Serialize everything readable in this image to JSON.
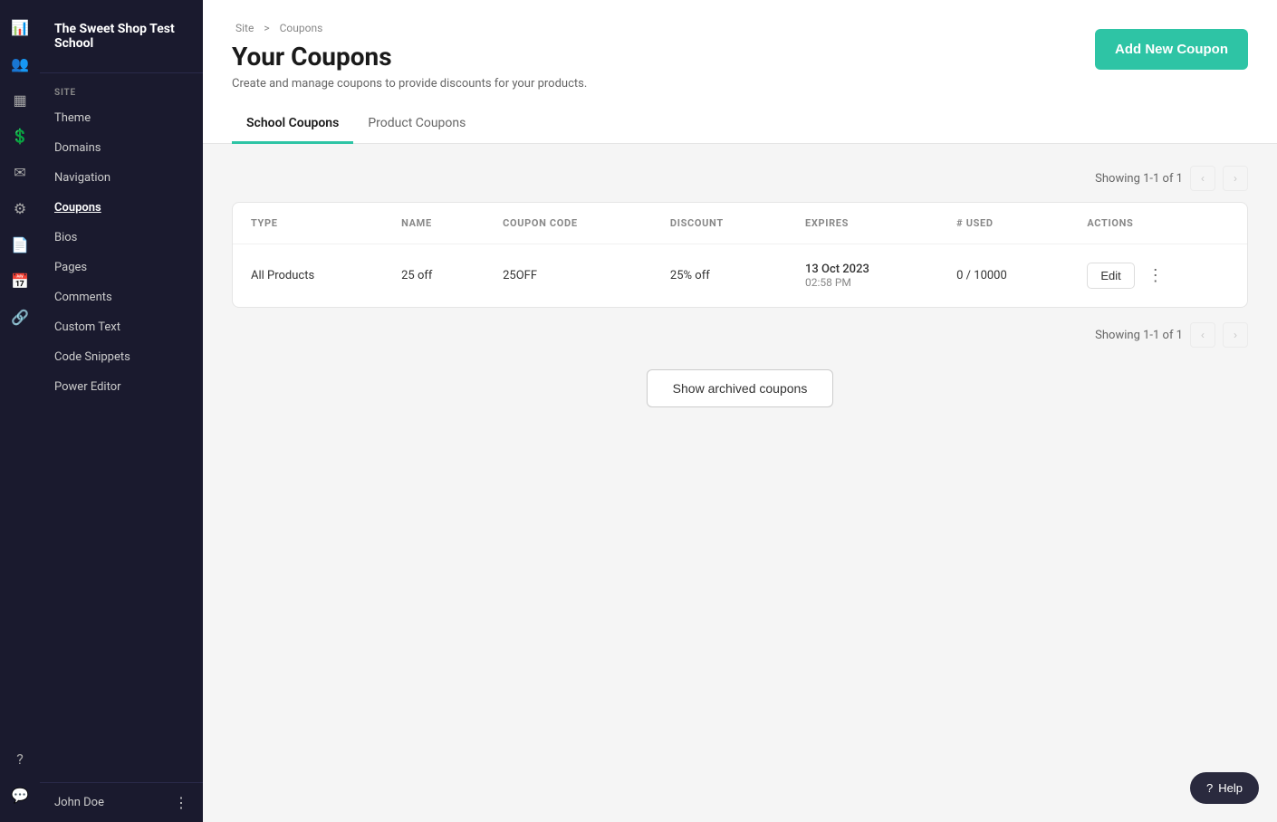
{
  "app": {
    "school_name": "The Sweet Shop Test School"
  },
  "icon_sidebar": {
    "items": [
      {
        "name": "chart-icon",
        "symbol": "📊"
      },
      {
        "name": "users-icon",
        "symbol": "👥"
      },
      {
        "name": "dashboard-icon",
        "symbol": "▦"
      },
      {
        "name": "dollar-icon",
        "symbol": "💲"
      },
      {
        "name": "mail-icon",
        "symbol": "✉"
      },
      {
        "name": "gear-icon",
        "symbol": "⚙"
      },
      {
        "name": "pages-icon",
        "symbol": "📄"
      },
      {
        "name": "calendar-icon",
        "symbol": "📅"
      },
      {
        "name": "link-icon",
        "symbol": "🔗"
      }
    ],
    "bottom": [
      {
        "name": "help-icon",
        "symbol": "?"
      },
      {
        "name": "message-icon",
        "symbol": "💬"
      }
    ]
  },
  "sidebar": {
    "section_label": "SITE",
    "items": [
      {
        "label": "Theme",
        "name": "theme"
      },
      {
        "label": "Domains",
        "name": "domains"
      },
      {
        "label": "Navigation",
        "name": "navigation"
      },
      {
        "label": "Coupons",
        "name": "coupons",
        "active": true
      },
      {
        "label": "Bios",
        "name": "bios"
      },
      {
        "label": "Pages",
        "name": "pages"
      },
      {
        "label": "Comments",
        "name": "comments"
      },
      {
        "label": "Custom Text",
        "name": "custom-text"
      },
      {
        "label": "Code Snippets",
        "name": "code-snippets"
      },
      {
        "label": "Power Editor",
        "name": "power-editor"
      }
    ],
    "footer": {
      "user_name": "John Doe"
    }
  },
  "header": {
    "breadcrumb_site": "Site",
    "breadcrumb_sep": ">",
    "breadcrumb_page": "Coupons",
    "page_title": "Your Coupons",
    "page_subtitle": "Create and manage coupons to provide discounts for your products.",
    "add_button_label": "Add New Coupon"
  },
  "tabs": [
    {
      "label": "School Coupons",
      "active": true
    },
    {
      "label": "Product Coupons",
      "active": false
    }
  ],
  "table": {
    "pagination_showing": "Showing 1-1 of 1",
    "columns": [
      {
        "label": "TYPE"
      },
      {
        "label": "NAME"
      },
      {
        "label": "COUPON CODE"
      },
      {
        "label": "DISCOUNT"
      },
      {
        "label": "EXPIRES"
      },
      {
        "label": "# USED"
      },
      {
        "label": "ACTIONS"
      }
    ],
    "rows": [
      {
        "type": "All Products",
        "name": "25 off",
        "coupon_code": "25OFF",
        "discount": "25% off",
        "expires_date": "13 Oct 2023",
        "expires_time": "02:58 PM",
        "used": "0",
        "used_max": "10000",
        "used_display": "0 / 10000",
        "edit_label": "Edit"
      }
    ],
    "pagination_showing_bottom": "Showing 1-1 of 1"
  },
  "archive_button_label": "Show archived coupons",
  "help_button_label": "Help"
}
